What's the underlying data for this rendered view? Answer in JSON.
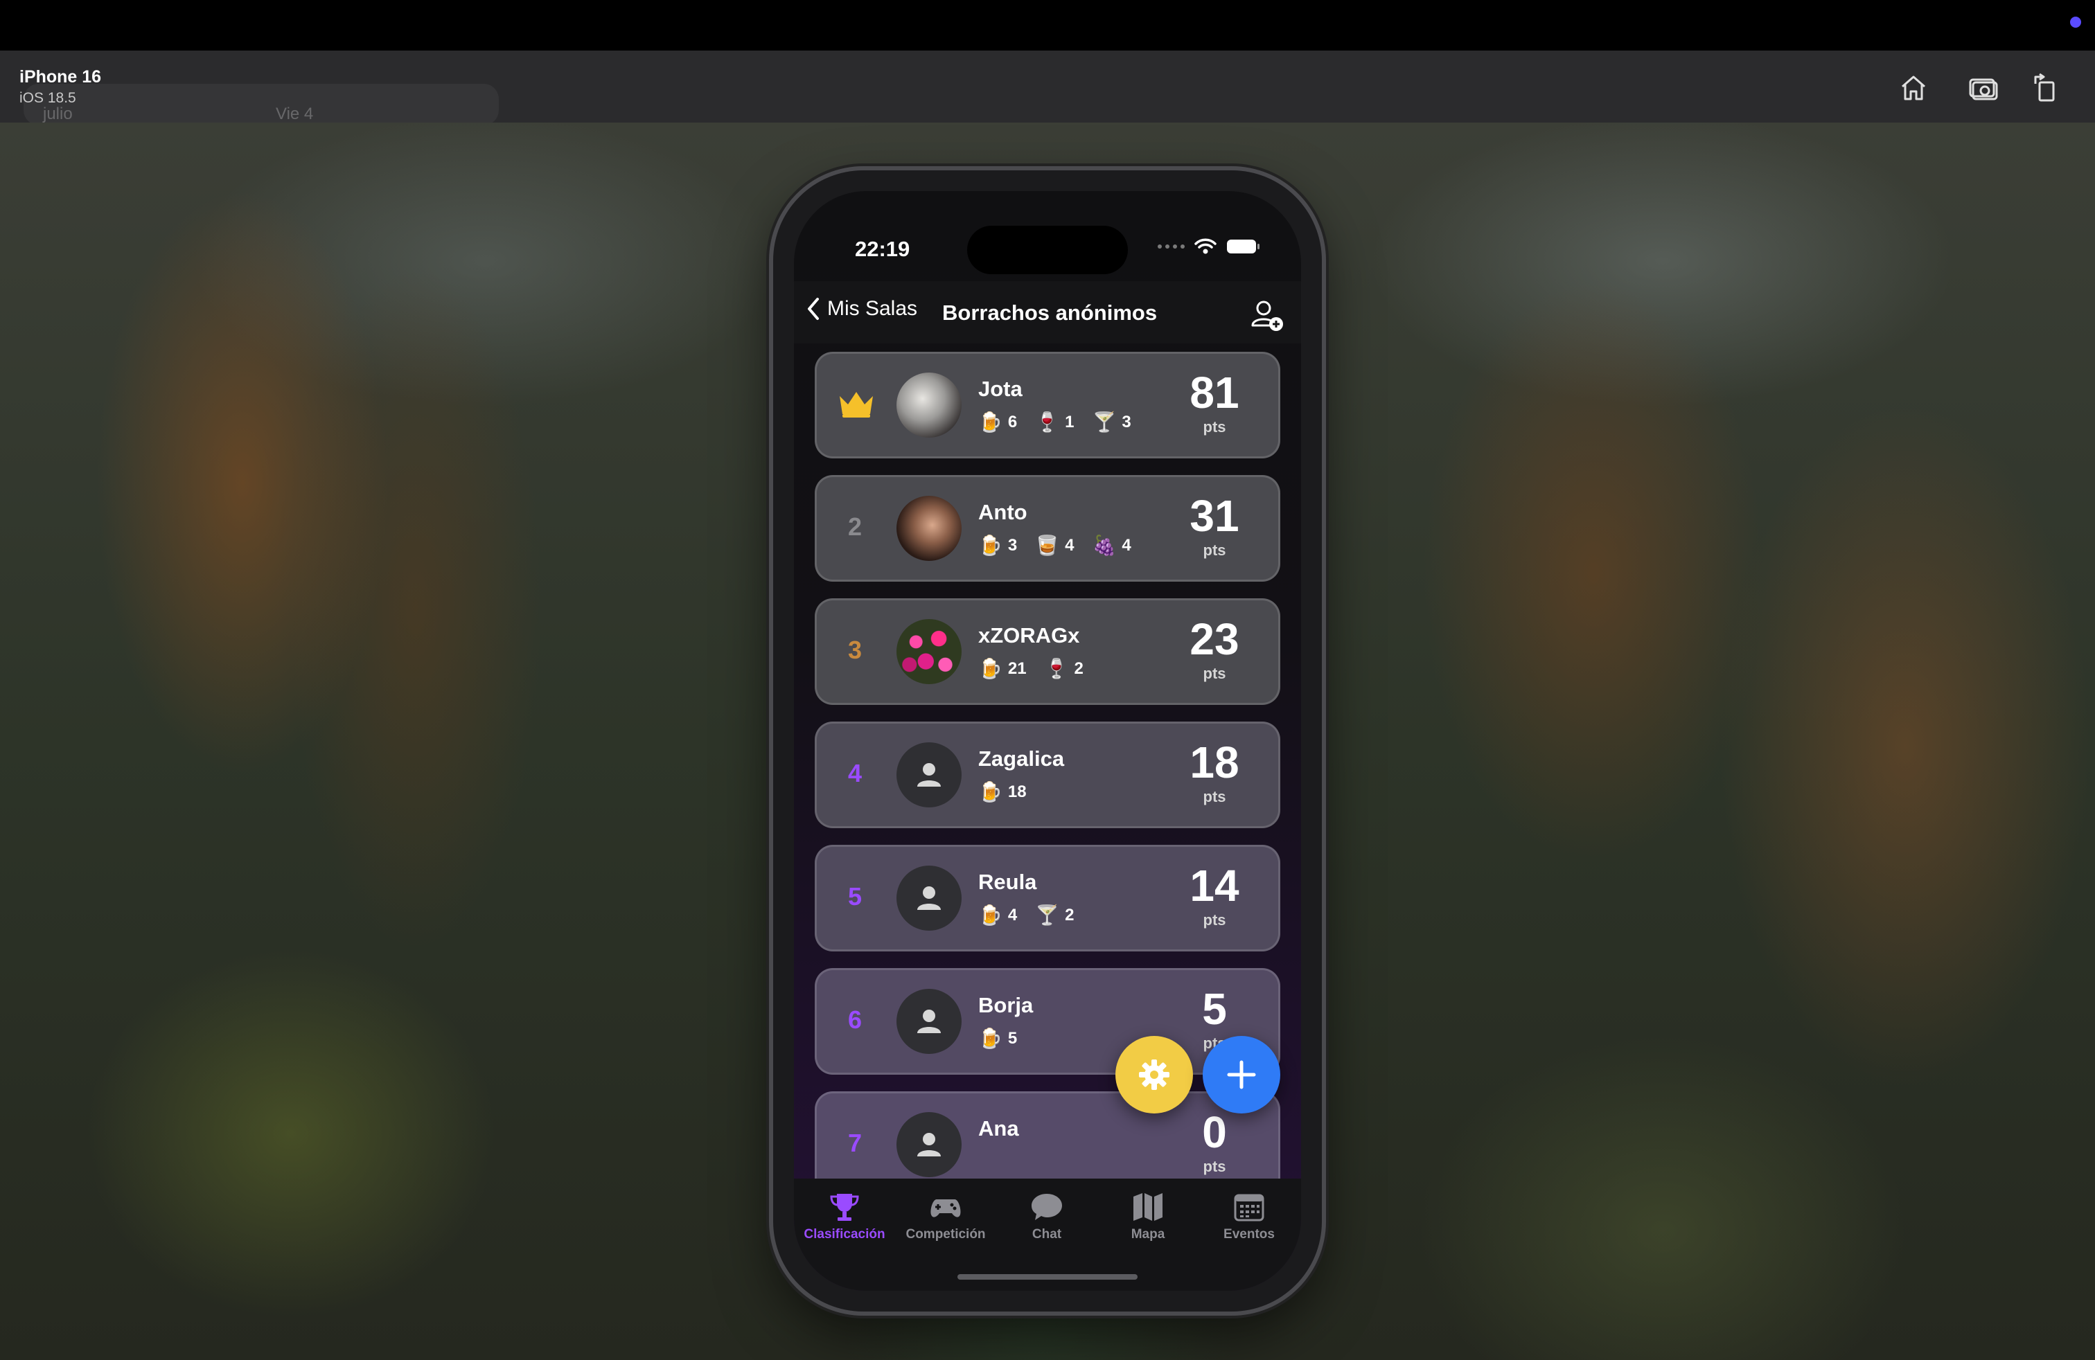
{
  "simulator": {
    "device_name": "iPhone 16",
    "os_version": "iOS 18.5",
    "ghost_left": "julio",
    "ghost_right": "Vie 4"
  },
  "status_bar": {
    "time": "22:19"
  },
  "nav": {
    "back_label": "Mis Salas",
    "title": "Borrachos anónimos"
  },
  "leaderboard": {
    "unit": "pts",
    "entries": [
      {
        "rank": "",
        "rank_icon": "crown-icon",
        "name": "Jota",
        "avatar": "photo",
        "score": "81",
        "drinks": [
          {
            "icon": "beer-icon",
            "glyph": "🍺",
            "count": "6"
          },
          {
            "icon": "wine-icon",
            "glyph": "🍷",
            "count": "1"
          },
          {
            "icon": "cocktail-icon",
            "glyph": "🍸",
            "count": "3"
          }
        ]
      },
      {
        "rank": "2",
        "rank_color": "#8a8a8e",
        "name": "Anto",
        "avatar": "photo",
        "score": "31",
        "drinks": [
          {
            "icon": "beer-icon",
            "glyph": "🍺",
            "count": "3"
          },
          {
            "icon": "shot-icon",
            "glyph": "🥃",
            "count": "4"
          },
          {
            "icon": "grapes-icon",
            "glyph": "🍇",
            "count": "4"
          }
        ]
      },
      {
        "rank": "3",
        "rank_color": "#c98a3e",
        "name": "xZORAGx",
        "avatar": "photo",
        "score": "23",
        "drinks": [
          {
            "icon": "beer-icon",
            "glyph": "🍺",
            "count": "21"
          },
          {
            "icon": "wine-icon",
            "glyph": "🍷",
            "count": "2"
          }
        ]
      },
      {
        "rank": "4",
        "rank_color": "#9a4bff",
        "name": "Zagalica",
        "avatar": "generic",
        "score": "18",
        "drinks": [
          {
            "icon": "beer-icon",
            "glyph": "🍺",
            "count": "18"
          }
        ]
      },
      {
        "rank": "5",
        "rank_color": "#9a4bff",
        "name": "Reula",
        "avatar": "generic",
        "score": "14",
        "drinks": [
          {
            "icon": "beer-icon",
            "glyph": "🍺",
            "count": "4"
          },
          {
            "icon": "cocktail-icon",
            "glyph": "🍸",
            "count": "2"
          }
        ]
      },
      {
        "rank": "6",
        "rank_color": "#9a4bff",
        "name": "Borja",
        "avatar": "generic",
        "score": "5",
        "drinks": [
          {
            "icon": "beer-icon",
            "glyph": "🍺",
            "count": "5"
          }
        ]
      },
      {
        "rank": "7",
        "rank_color": "#9a4bff",
        "name": "Ana",
        "avatar": "generic",
        "score": "0",
        "drinks": []
      }
    ]
  },
  "tabs": [
    {
      "label": "Clasificación",
      "icon": "trophy-icon",
      "active": true
    },
    {
      "label": "Competición",
      "icon": "gamepad-icon",
      "active": false
    },
    {
      "label": "Chat",
      "icon": "chat-bubble-icon",
      "active": false
    },
    {
      "label": "Mapa",
      "icon": "map-icon",
      "active": false
    },
    {
      "label": "Eventos",
      "icon": "calendar-icon",
      "active": false
    }
  ],
  "colors": {
    "accent": "#9a4bff",
    "settings_fab": "#f2cc45",
    "add_fab": "#2f7bf6"
  }
}
